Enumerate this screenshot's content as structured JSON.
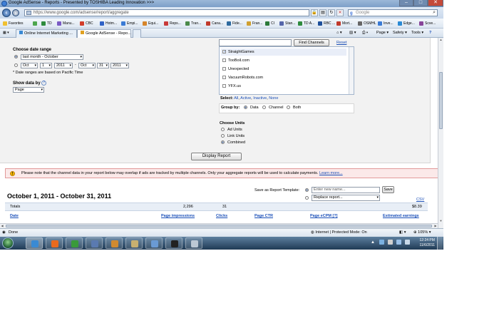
{
  "window": {
    "title": "Google AdSense - Reports - Presented by TOSHIBA Leading Innovation >>>",
    "controls": [
      "–",
      "□",
      "✕"
    ]
  },
  "address_bar": {
    "url": "https://www.google.com/adsense/report/aggregate",
    "search_placeholder": "Google"
  },
  "favorites_bar": {
    "label": "Favorites",
    "items": [
      "TD",
      "Manu...",
      "CBC",
      "Hotm...",
      "Empi...",
      "Equi...",
      "Reps...",
      "Tran...",
      "Cana...",
      "Fide...",
      "Fran...",
      "CI",
      "Stan...",
      "TD A...",
      "RBC ...",
      "Mort...",
      "OSMHL",
      "Inve...",
      "Edge...",
      "Scve..."
    ],
    "colors": [
      "#2e8b3d",
      "#7a5bc4",
      "#d23d2a",
      "#2f62c6",
      "#3a7bd5",
      "#d6852a",
      "#c83a3a",
      "#4a8a4a",
      "#c0392b",
      "#2d6a9f",
      "#d0a030",
      "#2b7a3a",
      "#5566aa",
      "#2e8b3d",
      "#1d4f9a",
      "#c0392b",
      "#666666",
      "#3a7bd5",
      "#2a8ad4",
      "#884499"
    ]
  },
  "tabs": [
    {
      "label": "Online Internet Marketing ..."
    },
    {
      "label": "Google AdSense - Repo...",
      "active": true
    }
  ],
  "command_bar": {
    "page": "Page ▾",
    "safety": "Safety ▾",
    "tools": "Tools ▾",
    "help": "?"
  },
  "report_form": {
    "date_range_title": "Choose date range",
    "preset_option": "last month - October",
    "custom_from": {
      "month": "Oct",
      "day": "1",
      "year": "2011"
    },
    "custom_to": {
      "month": "Oct",
      "day": "31",
      "year": "2011"
    },
    "date_separator": "-",
    "pacific_note": "* Date ranges are based on Pacific Time",
    "show_data_by_label": "Show data by",
    "show_data_by_value": "Page",
    "help_glyph": "?",
    "find_channels_button": "Find Channels",
    "reset_link": "Reset",
    "channels": [
      {
        "name": "StraightGames",
        "checked": true
      },
      {
        "name": "TooBoil.com",
        "checked": false
      },
      {
        "name": "Unexpected",
        "checked": false
      },
      {
        "name": "VacuumRobots.com",
        "checked": false
      },
      {
        "name": "YFX.us",
        "checked": false
      }
    ],
    "select_label": "Select:",
    "select_options": [
      "All",
      "Active",
      "Inactive",
      "None"
    ],
    "group_by_label": "Group by:",
    "group_by_options": [
      "Data",
      "Channel",
      "Both"
    ],
    "choose_units_title": "Choose Units",
    "units_options": [
      "Ad Units",
      "Link Units",
      "Combined"
    ],
    "display_report_button": "Display Report"
  },
  "warning": {
    "icon": "!",
    "text": "Please note that the channel data in your report below may overlap if ads are tracked by multiple channels. Only your aggregate reports will be used to calculate payments.",
    "link": "Learn more..."
  },
  "report": {
    "date_heading": "October 1, 2011 - October 31, 2011",
    "save_as_label": "Save as Report Template:",
    "new_name_placeholder": "Enter new name...",
    "save_button": "Save",
    "replace_label": "Replace report...",
    "csv_link": "CSV",
    "totals": {
      "label": "Totals",
      "impressions": "2,296",
      "clicks": "31",
      "earnings": "$8.39"
    },
    "columns": [
      "Date",
      "Page impressions",
      "Clicks",
      "Page CTR",
      "Page eCPM [?]",
      "Estimated earnings"
    ]
  },
  "status_bar": {
    "left": "Done",
    "zone": "Internet | Protected Mode: On",
    "zoom": "105%"
  },
  "taskbar": {
    "time": "12:24 PM",
    "date": "11/6/2011",
    "app_colors": [
      "#3a8ad4",
      "#e86a1e",
      "#3a9a3a",
      "#5a7ab0",
      "#d08a30",
      "#c8b070",
      "#6a9ad4",
      "#222222",
      "#bcc8d4"
    ]
  }
}
